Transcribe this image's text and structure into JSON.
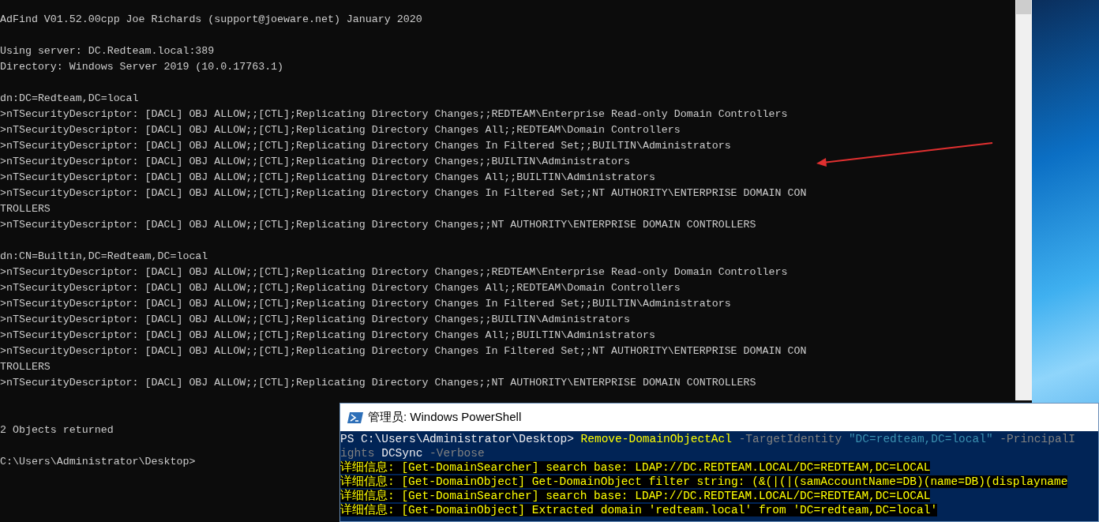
{
  "console": {
    "blocks": [
      {
        "kind": "header",
        "lines": [
          "AdFind V01.52.00cpp Joe Richards (support@joeware.net) January 2020"
        ]
      },
      {
        "kind": "text",
        "lines": [
          "Using server: DC.Redteam.local:389",
          "Directory: Windows Server 2019 (10.0.17763.1)"
        ]
      },
      {
        "kind": "text",
        "lines": [
          "dn:DC=Redteam,DC=local",
          ">nTSecurityDescriptor: [DACL] OBJ ALLOW;;[CTL];Replicating Directory Changes;;REDTEAM\\Enterprise Read-only Domain Controllers",
          ">nTSecurityDescriptor: [DACL] OBJ ALLOW;;[CTL];Replicating Directory Changes All;;REDTEAM\\Domain Controllers",
          ">nTSecurityDescriptor: [DACL] OBJ ALLOW;;[CTL];Replicating Directory Changes In Filtered Set;;BUILTIN\\Administrators",
          ">nTSecurityDescriptor: [DACL] OBJ ALLOW;;[CTL];Replicating Directory Changes;;BUILTIN\\Administrators",
          ">nTSecurityDescriptor: [DACL] OBJ ALLOW;;[CTL];Replicating Directory Changes All;;BUILTIN\\Administrators",
          ">nTSecurityDescriptor: [DACL] OBJ ALLOW;;[CTL];Replicating Directory Changes In Filtered Set;;NT AUTHORITY\\ENTERPRISE DOMAIN CON",
          "TROLLERS",
          ">nTSecurityDescriptor: [DACL] OBJ ALLOW;;[CTL];Replicating Directory Changes;;NT AUTHORITY\\ENTERPRISE DOMAIN CONTROLLERS"
        ]
      },
      {
        "kind": "text",
        "lines": [
          "dn:CN=Builtin,DC=Redteam,DC=local",
          ">nTSecurityDescriptor: [DACL] OBJ ALLOW;;[CTL];Replicating Directory Changes;;REDTEAM\\Enterprise Read-only Domain Controllers",
          ">nTSecurityDescriptor: [DACL] OBJ ALLOW;;[CTL];Replicating Directory Changes All;;REDTEAM\\Domain Controllers",
          ">nTSecurityDescriptor: [DACL] OBJ ALLOW;;[CTL];Replicating Directory Changes In Filtered Set;;BUILTIN\\Administrators",
          ">nTSecurityDescriptor: [DACL] OBJ ALLOW;;[CTL];Replicating Directory Changes;;BUILTIN\\Administrators",
          ">nTSecurityDescriptor: [DACL] OBJ ALLOW;;[CTL];Replicating Directory Changes All;;BUILTIN\\Administrators",
          ">nTSecurityDescriptor: [DACL] OBJ ALLOW;;[CTL];Replicating Directory Changes In Filtered Set;;NT AUTHORITY\\ENTERPRISE DOMAIN CON",
          "TROLLERS",
          ">nTSecurityDescriptor: [DACL] OBJ ALLOW;;[CTL];Replicating Directory Changes;;NT AUTHORITY\\ENTERPRISE DOMAIN CONTROLLERS"
        ]
      },
      {
        "kind": "summary",
        "lines": [
          "2 Objects returned"
        ]
      },
      {
        "kind": "text",
        "lines": [
          "C:\\Users\\Administrator\\Desktop>"
        ]
      }
    ]
  },
  "powershell": {
    "title": "管理员: Windows PowerShell",
    "lines": [
      {
        "kind": "command",
        "segments": [
          {
            "kind": "prompt",
            "text": "PS C:\\Users\\Administrator\\Desktop>"
          },
          {
            "kind": "command",
            "text": "Remove-DomainObjectAcl"
          },
          {
            "kind": "parameter",
            "text": "-TargetIdentity"
          },
          {
            "kind": "string",
            "text": "\"DC=redteam,DC=local\""
          },
          {
            "kind": "parameter",
            "text": "-PrincipalI"
          }
        ]
      },
      {
        "kind": "command",
        "segments": [
          {
            "kind": "parameter",
            "text": "ights"
          },
          {
            "kind": "argument",
            "text": "DCSync"
          },
          {
            "kind": "parameter",
            "text": "-Verbose"
          }
        ]
      },
      {
        "kind": "verbose",
        "text": "详细信息: [Get-DomainSearcher] search base: LDAP://DC.REDTEAM.LOCAL/DC=REDTEAM,DC=LOCAL"
      },
      {
        "kind": "verbose",
        "text": "详细信息: [Get-DomainObject] Get-DomainObject filter string: (&(|(|(samAccountName=DB)(name=DB)(displayname"
      },
      {
        "kind": "verbose",
        "text": "详细信息: [Get-DomainSearcher] search base: LDAP://DC.REDTEAM.LOCAL/DC=REDTEAM,DC=LOCAL"
      },
      {
        "kind": "verbose",
        "text": "详细信息: [Get-DomainObject] Extracted domain 'redteam.local' from 'DC=redteam,DC=local'"
      }
    ]
  }
}
